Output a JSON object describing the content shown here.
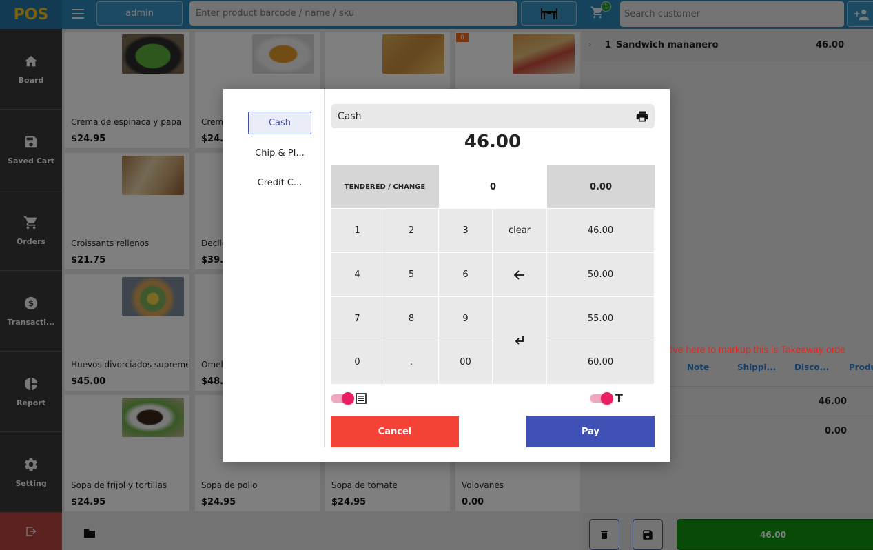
{
  "app": {
    "logo": "POS"
  },
  "topbar": {
    "user_label": "admin",
    "product_search_placeholder": "Enter product barcode / name / sku",
    "cart_count": "1",
    "customer_search_placeholder": "Search customer"
  },
  "sidebar": {
    "items": [
      {
        "label": "Board",
        "icon": "home-icon"
      },
      {
        "label": "Saved Cart",
        "icon": "save-icon"
      },
      {
        "label": "Orders",
        "icon": "cart-icon"
      },
      {
        "label": "Transacti...",
        "icon": "dollar-icon"
      },
      {
        "label": "Report",
        "icon": "pie-chart-icon"
      },
      {
        "label": "Setting",
        "icon": "gear-icon"
      }
    ],
    "logout_icon": "logout-icon"
  },
  "products": [
    {
      "name": "Crema de espinaca y papa",
      "price": "$24.95"
    },
    {
      "name": "Crema",
      "price": "$24.9"
    },
    {
      "name": "",
      "price": ""
    },
    {
      "name": "",
      "price": ""
    },
    {
      "name": "Croissants rellenos",
      "price": "$21.75"
    },
    {
      "name": "Decile",
      "price": "$39.0"
    },
    {
      "name": "Huevos divorciados supreme",
      "price": "$45.00"
    },
    {
      "name": "Omele",
      "price": "$48.0"
    },
    {
      "name": "Sopa de frijol y tortillas",
      "price": "$24.95"
    },
    {
      "name": "Sopa de pollo",
      "price": "$24.95"
    },
    {
      "name": "Sopa de tomate",
      "price": "$24.95"
    },
    {
      "name": "Volovanes",
      "price": "0.00"
    }
  ],
  "product_qty_badge": "0",
  "cart": {
    "line": {
      "qty": "1",
      "name": "Sandwich mañanero",
      "amount": "46.00"
    },
    "tabs": [
      "Note",
      "Shippi...",
      "Disco...",
      "Produ"
    ],
    "subtotal": "46.00",
    "discount": "0.00",
    "checkout_total": "46.00"
  },
  "payment_modal": {
    "methods": [
      "Cash",
      "Chip & PI...",
      "Credit C..."
    ],
    "active_method": "Cash",
    "selected_method_title": "Cash",
    "total": "46.00",
    "tendered_change_label": "TENDERED / CHANGE",
    "tendered": "0",
    "change": "0.00",
    "keys": [
      "1",
      "2",
      "3",
      "clear",
      "4",
      "5",
      "6",
      "7",
      "8",
      "9",
      "0",
      ".",
      "00"
    ],
    "quick_amounts": [
      "46.00",
      "50.00",
      "55.00",
      "60.00"
    ],
    "takeaway_toggle_label": "T",
    "cancel_label": "Cancel",
    "pay_label": "Pay"
  },
  "annotation": {
    "text": "active here to markup this is Takeaway orde",
    "color": "#e8261e"
  },
  "colors": {
    "topbar": "#2b86b8",
    "sidebar": "#383838",
    "primary": "#3f51b5",
    "danger": "#f44336",
    "toggle": "#e91e63",
    "checkout": "#10950f",
    "logo": "#f5c518"
  }
}
